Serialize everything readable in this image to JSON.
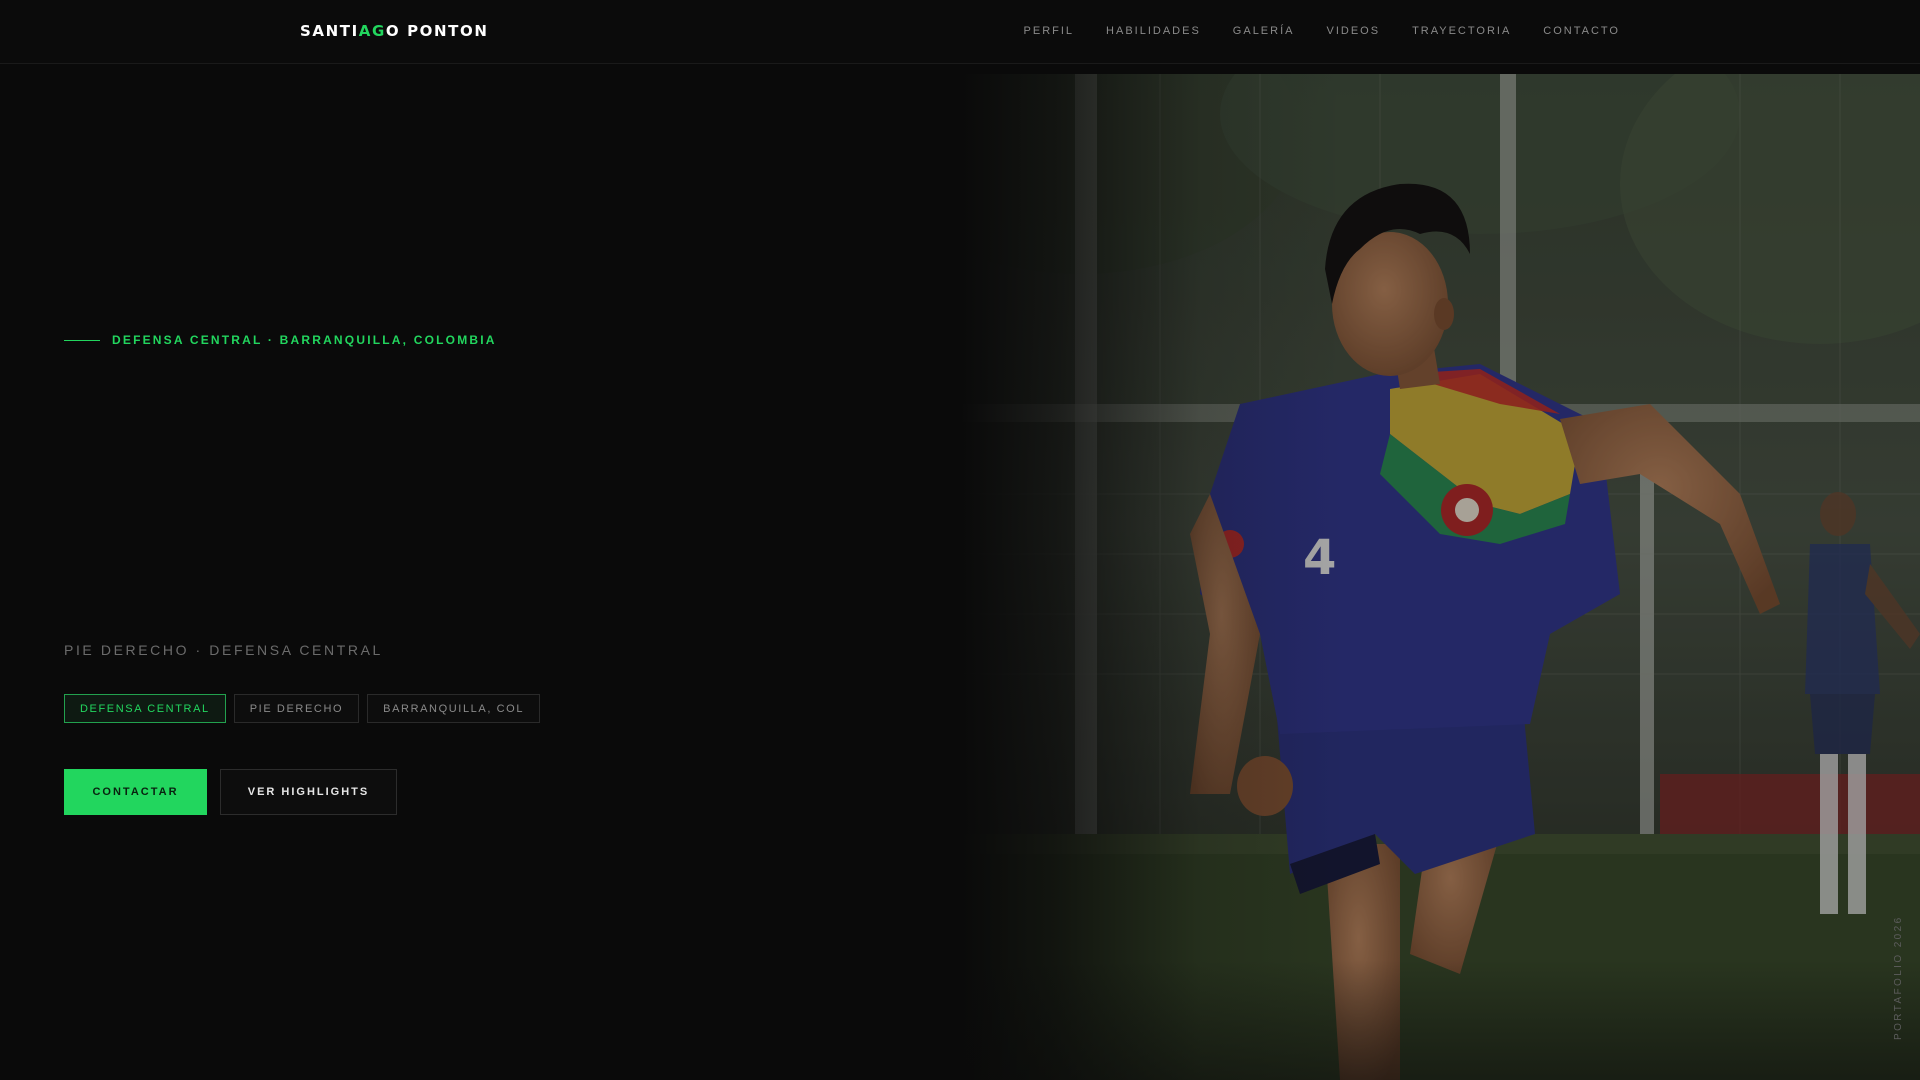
{
  "brand": {
    "logo_part1": "SANTI",
    "logo_accent": "AG",
    "logo_part2": "O PONTON",
    "accent_color": "#22d65e"
  },
  "nav": {
    "items": [
      {
        "label": "PERFIL"
      },
      {
        "label": "HABILIDADES"
      },
      {
        "label": "GALERÍA"
      },
      {
        "label": "VIDEOS"
      },
      {
        "label": "TRAYECTORIA"
      },
      {
        "label": "CONTACTO"
      }
    ]
  },
  "hero": {
    "eyebrow": "DEFENSA CENTRAL · BARRANQUILLA, COLOMBIA",
    "subtitle": "PIE DERECHO · DEFENSA CENTRAL",
    "tags": [
      {
        "label": "DEFENSA CENTRAL",
        "active": true
      },
      {
        "label": "PIE DERECHO",
        "active": false
      },
      {
        "label": "BARRANQUILLA, COL",
        "active": false
      }
    ],
    "primary_cta": "CONTACTAR",
    "secondary_cta": "VER HIGHLIGHTS",
    "side_label": "PORTAFOLIO 2026",
    "photo_subject": "football-player-running"
  }
}
